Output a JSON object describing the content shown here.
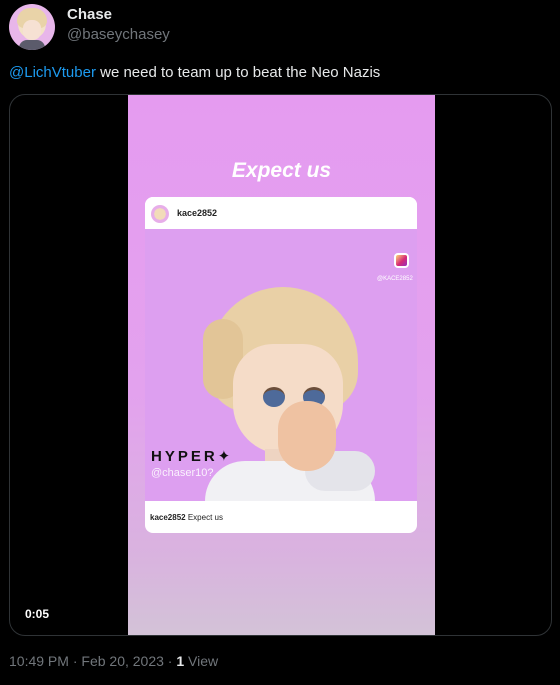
{
  "author": {
    "name": "Chase",
    "handle": "@baseychasey"
  },
  "tweet": {
    "mention": "@LichVtuber",
    "text": "we need to team up to beat the Neo Nazis"
  },
  "video": {
    "overlay_title": "Expect us",
    "card_user": "kace2852",
    "ig_tag": "@KACE2852",
    "hyper_text": "HYPER✦",
    "watermark": "@chaser10?",
    "caption_user": "kace2852",
    "caption_text": "Expect us",
    "timecode": "0:05"
  },
  "meta": {
    "time": "10:49 PM",
    "sep": "·",
    "date": "Feb 20, 2023",
    "views_count": "1",
    "views_label": "View"
  },
  "colors": {
    "background": "#000000",
    "link": "#1d9bf0",
    "secondary_text": "#71767b",
    "video_bg": "#e59bf0"
  }
}
